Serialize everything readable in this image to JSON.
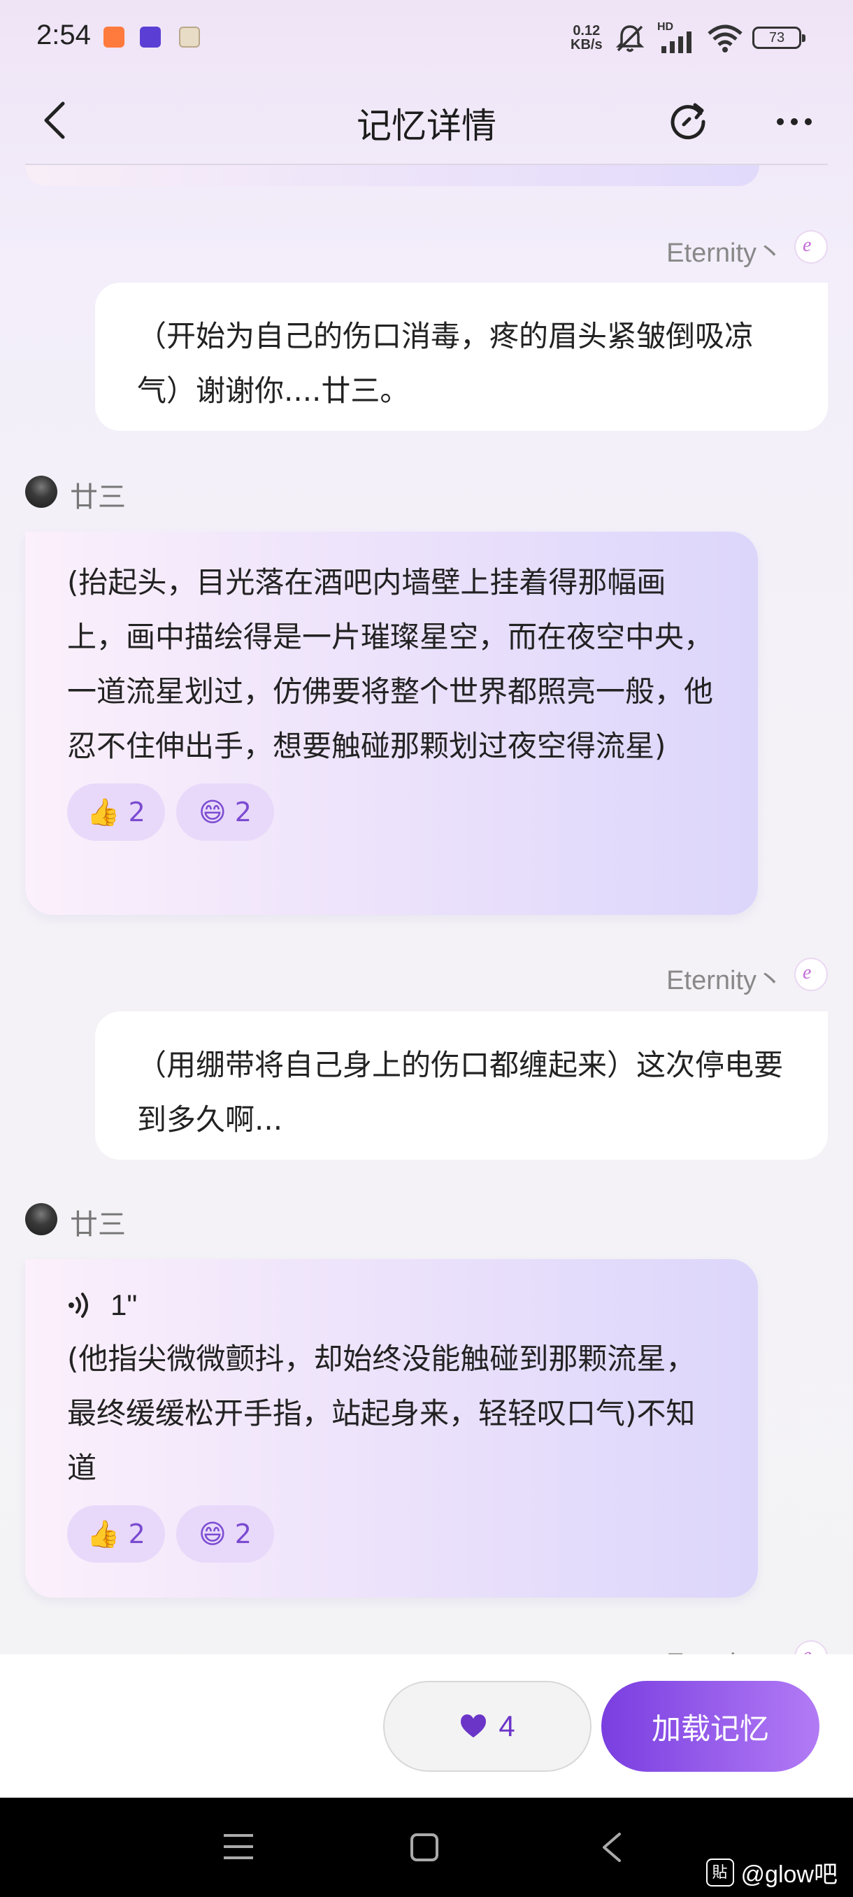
{
  "status_bar": {
    "time": "2:54",
    "net_speed": "0.12",
    "net_unit": "KB/s",
    "hd_label": "HD",
    "battery": "73"
  },
  "nav": {
    "title": "记忆详情"
  },
  "messages": [
    {
      "role": "user",
      "name": "Eternity丶",
      "text": "（开始为自己的伤口消毒，疼的眉头紧皱倒吸凉气）谢谢你....廿三。"
    },
    {
      "role": "ai",
      "name": "廿三",
      "text": "(抬起头，目光落在酒吧内墙壁上挂着得那幅画上，画中描绘得是一片璀璨星空，而在夜空中央，一道流星划过，仿佛要将整个世界都照亮一般，他忍不住伸出手，想要触碰那颗划过夜空得流星)",
      "reactions": [
        {
          "emoji": "👍",
          "count": "2"
        },
        {
          "emoji": "😄",
          "count": "2"
        }
      ]
    },
    {
      "role": "user",
      "name": "Eternity丶",
      "text": "（用绷带将自己身上的伤口都缠起来）这次停电要到多久啊..."
    },
    {
      "role": "ai",
      "name": "廿三",
      "voice_duration": "1\"",
      "text": "(他指尖微微颤抖，却始终没能触碰到那颗流星，最终缓缓松开手指，站起身来，轻轻叹口气)不知道",
      "reactions": [
        {
          "emoji": "👍",
          "count": "2"
        },
        {
          "emoji": "😄",
          "count": "2"
        }
      ]
    },
    {
      "role": "user",
      "name": "Eternity丶"
    }
  ],
  "bottom": {
    "like_count": "4",
    "load_label": "加载记忆"
  },
  "watermark": {
    "logo": "貼",
    "text": "@glow吧"
  },
  "colors": {
    "accent": "#7b4bd1",
    "button_gradient_start": "#7a3ee0",
    "button_gradient_end": "#b27bf5"
  }
}
